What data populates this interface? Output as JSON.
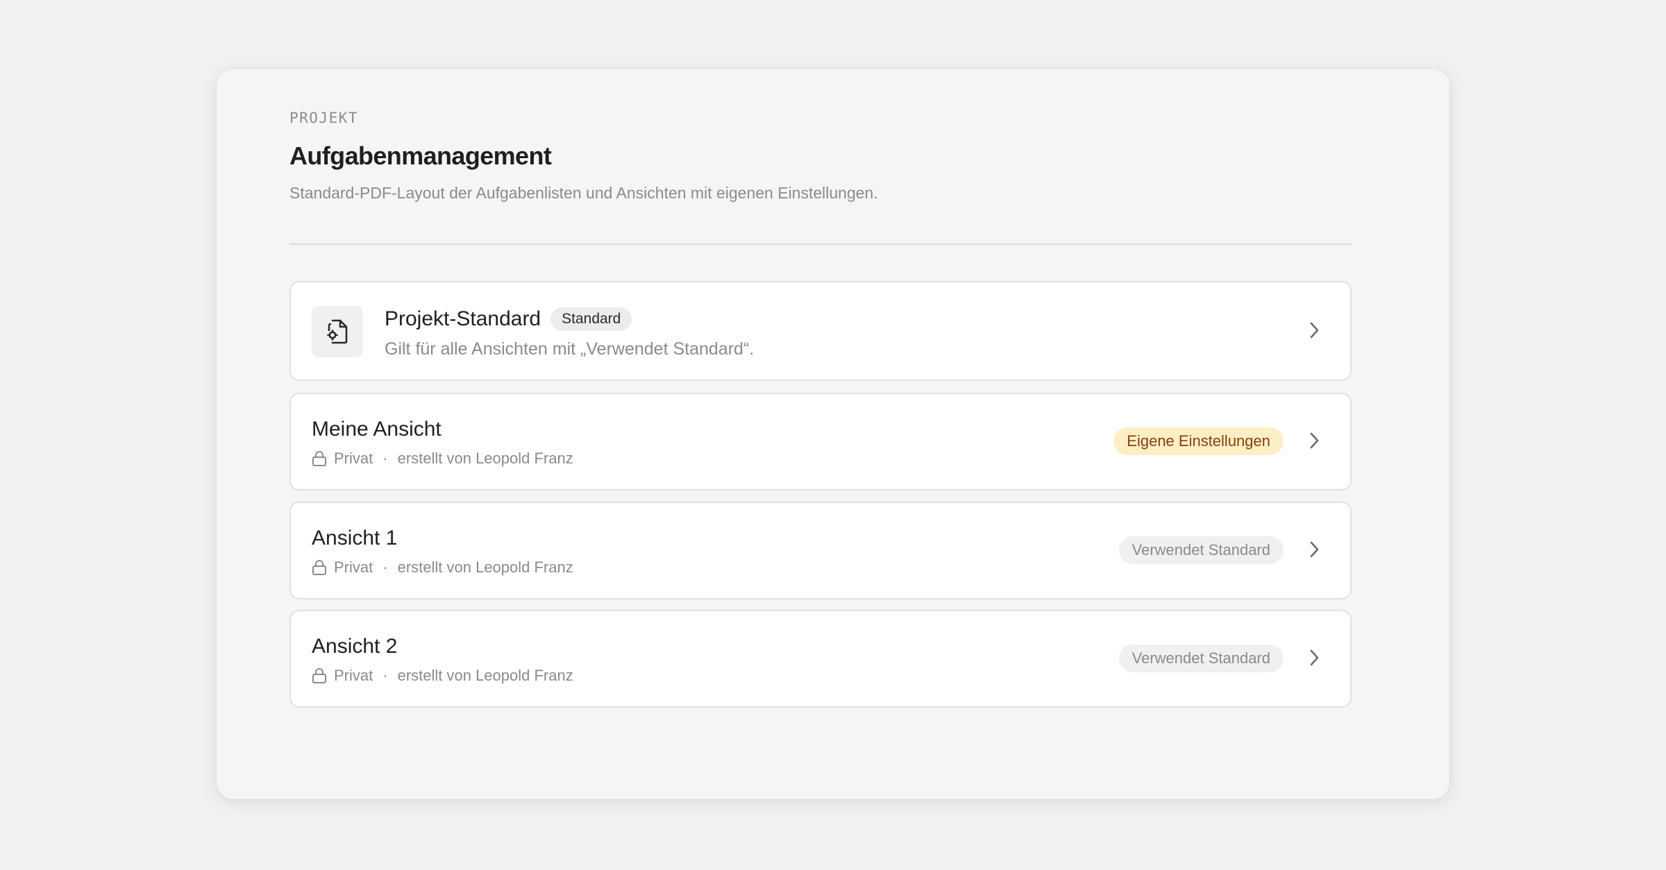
{
  "header": {
    "eyebrow": "PROJEKT",
    "title": "Aufgabenmanagement",
    "subtitle": "Standard-PDF-Layout der Aufgabenlisten und Ansichten mit eigenen Einstellungen."
  },
  "project_default": {
    "title": "Projekt-Standard",
    "badge": "Standard",
    "description": "Gilt für alle Ansichten mit „Verwendet Standard“.",
    "icon": "document-settings-icon"
  },
  "views": [
    {
      "title": "Meine Ansicht",
      "visibility": "Privat",
      "separator": "·",
      "creator": "erstellt von Leopold Franz",
      "status": "Eigene Einstellungen",
      "status_kind": "custom"
    },
    {
      "title": "Ansicht 1",
      "visibility": "Privat",
      "separator": "·",
      "creator": "erstellt von Leopold Franz",
      "status": "Verwendet Standard",
      "status_kind": "default"
    },
    {
      "title": "Ansicht 2",
      "visibility": "Privat",
      "separator": "·",
      "creator": "erstellt von Leopold Franz",
      "status": "Verwendet Standard",
      "status_kind": "default"
    }
  ],
  "colors": {
    "background": "#f2f2f1",
    "panel": "#f6f5f3",
    "card": "#ffffff",
    "custom_badge_bg": "#fcefc6",
    "custom_badge_text": "#8a3d10",
    "default_badge_bg": "#f1f0ee",
    "muted_text": "#8a8a8a"
  }
}
